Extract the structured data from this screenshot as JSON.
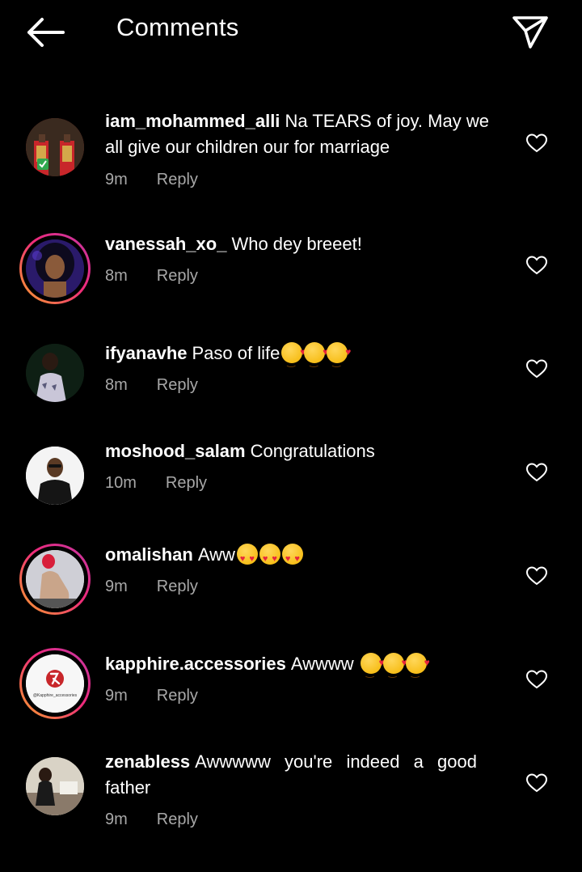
{
  "header": {
    "title": "Comments",
    "back_icon": "arrow-left-icon",
    "share_icon": "send-icon"
  },
  "comments": [
    {
      "username": "iam_mohammed_alli",
      "text": "Na TEARS of joy. May we all give our children our  for marriage",
      "time": "9m",
      "reply": "Reply"
    },
    {
      "username": "vanessah_xo_",
      "text": "Who dey breeet!",
      "time": "8m",
      "reply": "Reply"
    },
    {
      "username": "ifyanavhe",
      "text": "Paso of life",
      "time": "8m",
      "reply": "Reply",
      "emojis": [
        "smiling-face-with-hearts",
        "smiling-face-with-hearts",
        "smiling-face-with-hearts"
      ]
    },
    {
      "username": "moshood_salam",
      "text": "Congratulations",
      "time": "10m",
      "reply": "Reply"
    },
    {
      "username": "omalishan",
      "text": "Aww",
      "time": "9m",
      "reply": "Reply",
      "emojis": [
        "heart-eyes",
        "heart-eyes",
        "heart-eyes"
      ]
    },
    {
      "username": "kapphire.accessories",
      "text": "Awwww ",
      "time": "9m",
      "reply": "Reply",
      "emojis": [
        "smiling-face-with-hearts",
        "smiling-face-with-hearts",
        "smiling-face-with-hearts"
      ],
      "avatar_logo_text": "@Kapphire_accessories"
    },
    {
      "username": "zenabless",
      "text": "Awwwww you're indeed a good father",
      "time": "9m",
      "reply": "Reply"
    }
  ],
  "colors": {
    "background": "#000000",
    "text": "#ffffff",
    "meta": "#a8a8a8",
    "story_ring_start": "#f9a22b",
    "story_ring_end": "#c236a4"
  }
}
